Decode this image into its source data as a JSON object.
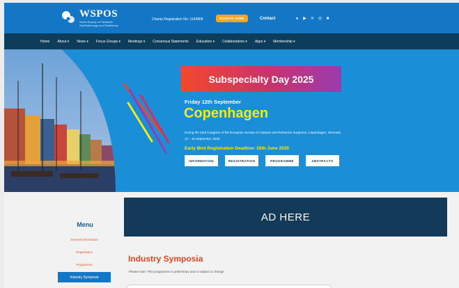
{
  "header": {
    "brand": "WSPOS",
    "tagline": "World Society of Paediatric Ophthalmology and Strabismus",
    "charity": "Charity Registration No: 1144806",
    "donate": "DONATE HERE",
    "contact": "Contact",
    "social_icons": [
      "facebook-icon",
      "youtube-icon",
      "x-icon",
      "instagram-icon",
      "linkedin-icon"
    ]
  },
  "nav": [
    "Home",
    "About ▾",
    "News ▾",
    "Focus Groups ▾",
    "Meetings ▾",
    "Consensus Statements",
    "Education ▾",
    "Collaborations ▾",
    "Apps ▾",
    "Membership ▾"
  ],
  "hero": {
    "title": "Subspecialty Day 2025",
    "date": "Friday 12th September",
    "city": "Copenhagen",
    "desc": "During the 43rd Congress of the European Society of Cataract and Refractive Surgeons, Copenhagen, Denmark, 12 – 16 September, 2025",
    "early": "Early Bird Registration Deadline: 25th June 2025",
    "buttons": [
      "INFORMATION",
      "REGISTRATION",
      "PROGRAMME",
      "ABSTRACTS"
    ]
  },
  "ad": "AD HERE",
  "menu": {
    "title": "Menu",
    "items": [
      "General Information",
      "Registration",
      "Programme"
    ],
    "active": "Industry Symposia"
  },
  "content": {
    "title": "Industry Symposia",
    "note": "Please note: This programme is preliminary and is subject to change"
  },
  "colors": {
    "topbar": "#1377c5",
    "nav": "#0e3d5c",
    "hero": "#1a8fd8",
    "accent_yellow": "#f4ea18",
    "accent_orange": "#e5441f"
  }
}
